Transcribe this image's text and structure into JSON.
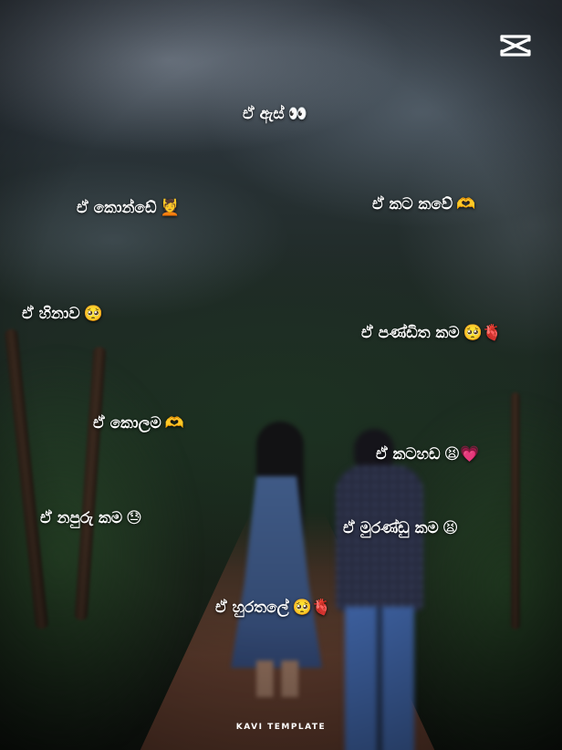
{
  "captions": [
    {
      "text": "ඒ ඇස්",
      "emoji": "👀"
    },
    {
      "text": "ඒ කොන්ඩේ",
      "emoji": "💆"
    },
    {
      "text": "ඒ කට කවේ",
      "emoji": "🫶"
    },
    {
      "text": "ඒ හිනාව",
      "emoji": "🥺"
    },
    {
      "text": "ඒ පණ්ඩිත කම",
      "emoji": "🥺🫀"
    },
    {
      "text": "ඒ කොලම",
      "emoji": "🫶"
    },
    {
      "text": "ඒ කටහඩ",
      "emoji": "😫💗"
    },
    {
      "text": "ඒ නපුරු කම",
      "emoji": "😓"
    },
    {
      "text": "ඒ මුරණ්ඩු කම",
      "emoji": "😫"
    },
    {
      "text": "ඒ හුරතලේ",
      "emoji": "🥺🫀"
    }
  ],
  "watermark": "KAVI TEMPLATE",
  "logo_icon": "capcut-icon"
}
